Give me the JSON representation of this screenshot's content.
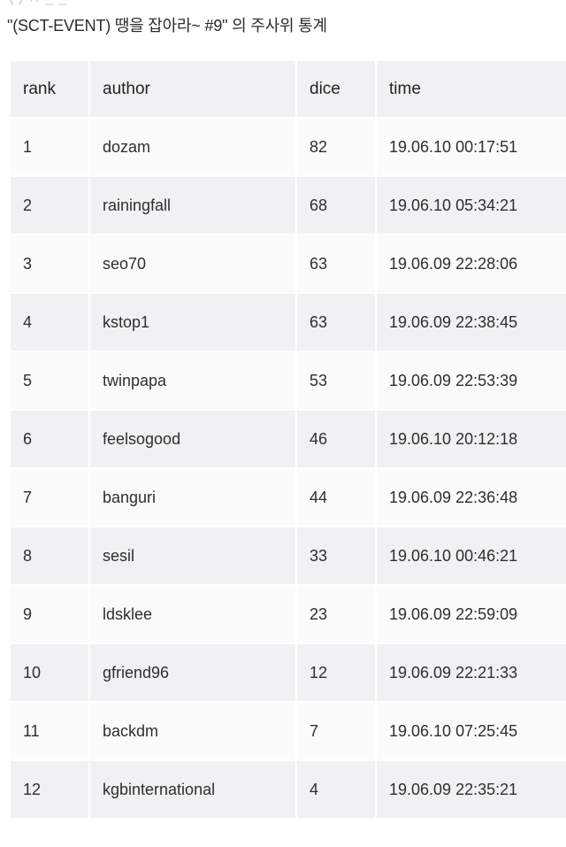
{
  "clipped_top_text": "(   ) \\  /     _  _",
  "page_title": "\"(SCT-EVENT) 땡을 잡아라~ #9\" 의 주사위 통계",
  "table": {
    "columns": [
      {
        "key": "rank",
        "label": "rank"
      },
      {
        "key": "author",
        "label": "author"
      },
      {
        "key": "dice",
        "label": "dice"
      },
      {
        "key": "time",
        "label": "time"
      }
    ],
    "rows": [
      {
        "rank": "1",
        "author": "dozam",
        "dice": "82",
        "time": "19.06.10 00:17:51"
      },
      {
        "rank": "2",
        "author": "rainingfall",
        "dice": "68",
        "time": "19.06.10 05:34:21"
      },
      {
        "rank": "3",
        "author": "seo70",
        "dice": "63",
        "time": "19.06.09 22:28:06"
      },
      {
        "rank": "4",
        "author": "kstop1",
        "dice": "63",
        "time": "19.06.09 22:38:45"
      },
      {
        "rank": "5",
        "author": "twinpapa",
        "dice": "53",
        "time": "19.06.09 22:53:39"
      },
      {
        "rank": "6",
        "author": "feelsogood",
        "dice": "46",
        "time": "19.06.10 20:12:18"
      },
      {
        "rank": "7",
        "author": "banguri",
        "dice": "44",
        "time": "19.06.09 22:36:48"
      },
      {
        "rank": "8",
        "author": "sesil",
        "dice": "33",
        "time": "19.06.10 00:46:21"
      },
      {
        "rank": "9",
        "author": "ldsklee",
        "dice": "23",
        "time": "19.06.09 22:59:09"
      },
      {
        "rank": "10",
        "author": "gfriend96",
        "dice": "12",
        "time": "19.06.09 22:21:33"
      },
      {
        "rank": "11",
        "author": "backdm",
        "dice": "7",
        "time": "19.06.10 07:25:45"
      },
      {
        "rank": "12",
        "author": "kgbinternational",
        "dice": "4",
        "time": "19.06.09 22:35:21"
      }
    ]
  },
  "colors": {
    "page_background": "#ffffff",
    "header_cell_background": "#f1f1f3",
    "row_odd_background": "#fbfbfc",
    "row_even_background": "#f1f1f3",
    "text": "#2e2e2e",
    "title_text": "#2b2b2b"
  }
}
